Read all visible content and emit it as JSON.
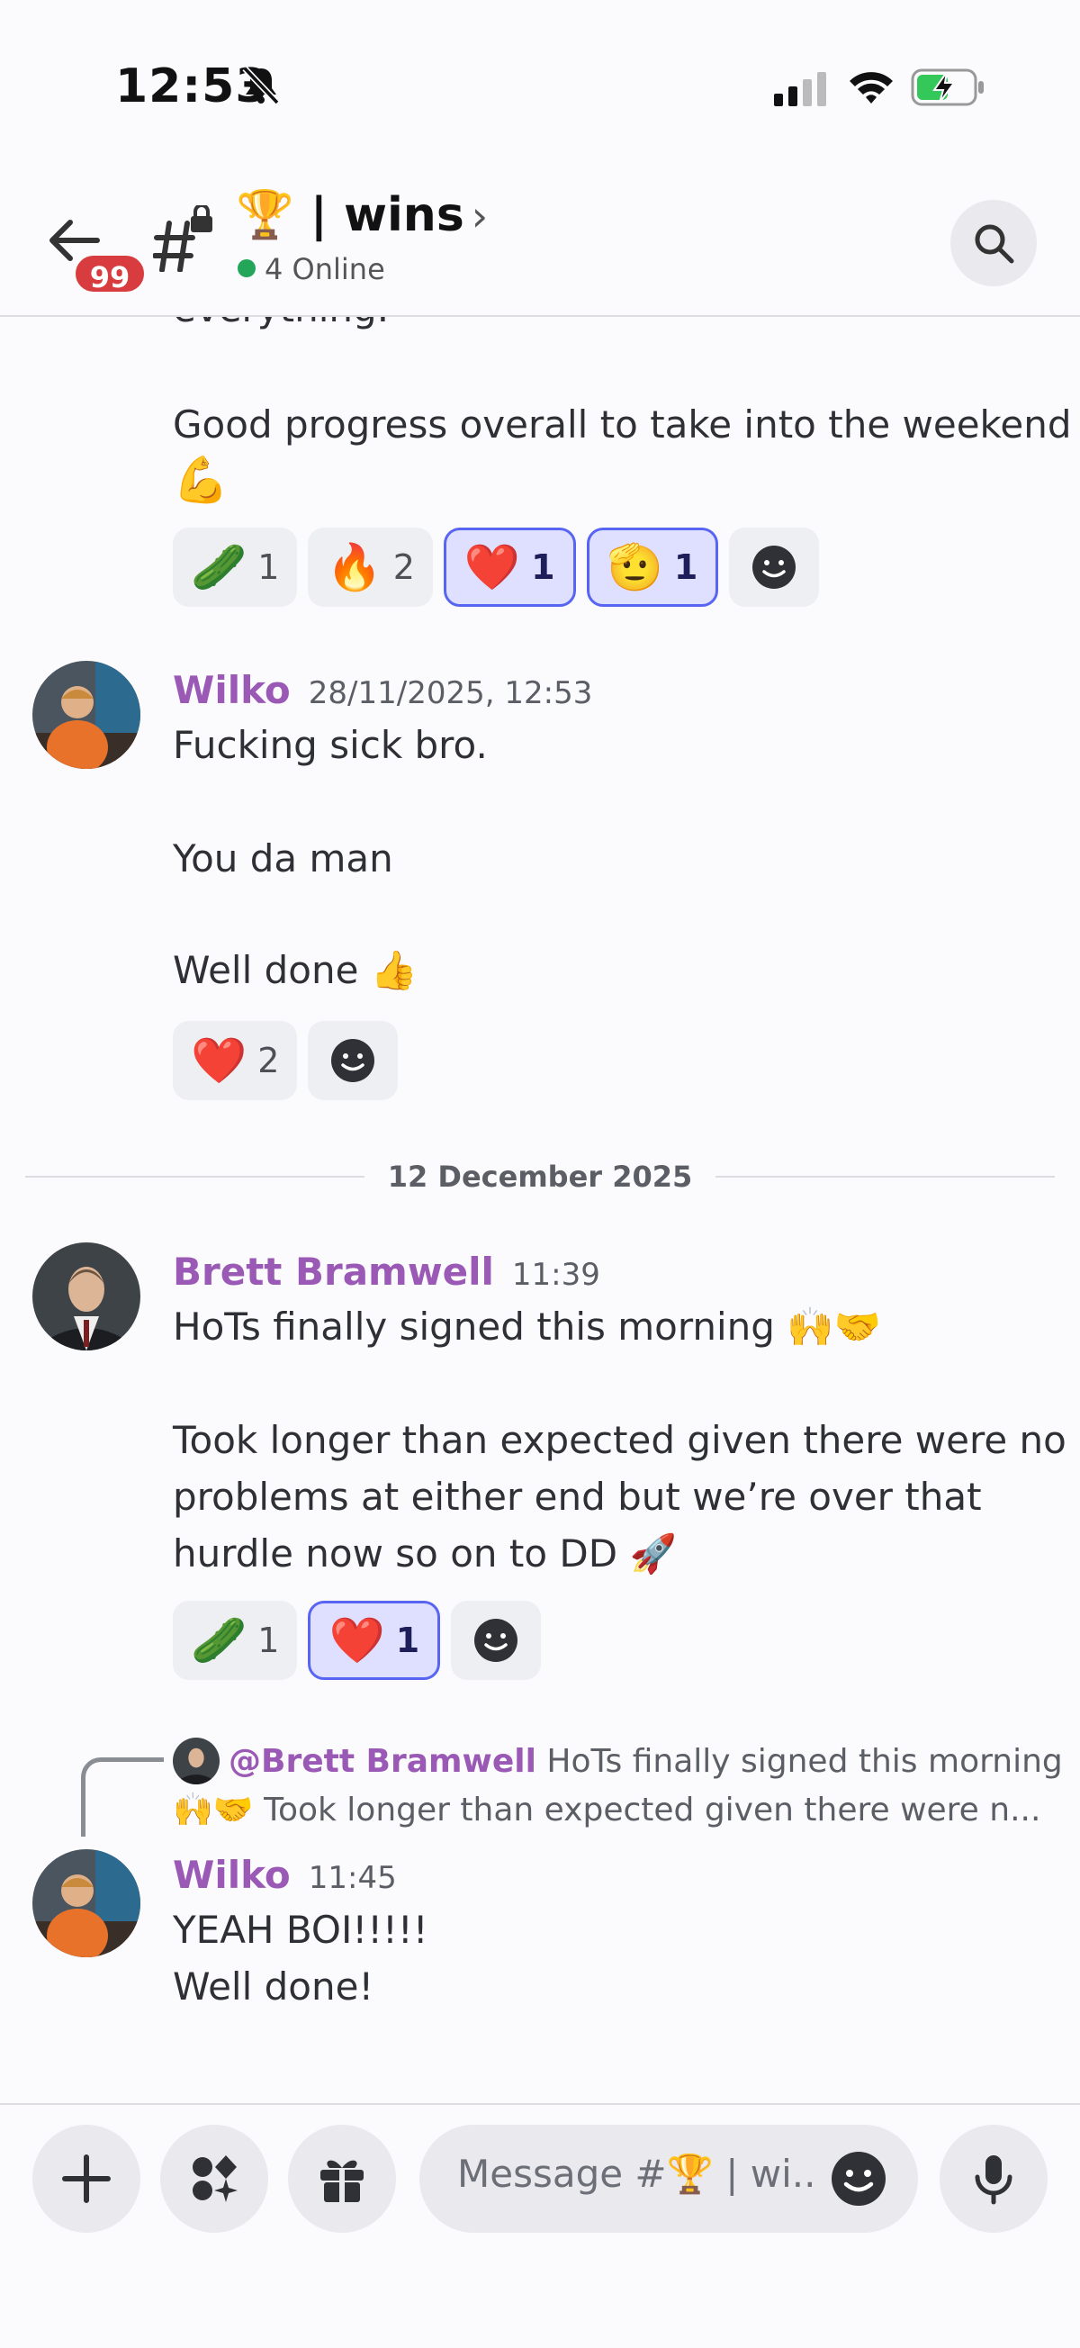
{
  "status_bar": {
    "time": "12:53"
  },
  "header": {
    "unread_badge": "99",
    "channel_name": "🏆 | wins",
    "chevron": "›",
    "online": "4 Online"
  },
  "messages": [
    {
      "type": "continuation",
      "cut_text": "everything.",
      "text": [
        "Good progress overall to take into the weekend",
        "💪"
      ],
      "reactions": [
        {
          "emoji": "🥒",
          "count": "1",
          "mine": false
        },
        {
          "emoji": "🔥",
          "count": "2",
          "mine": false
        },
        {
          "emoji": "❤️",
          "count": "1",
          "mine": true
        },
        {
          "emoji": "🫡",
          "count": "1",
          "mine": true
        }
      ]
    },
    {
      "author": "Wilko",
      "timestamp": "28/11/2025, 12:53",
      "text": [
        "Fucking sick bro.",
        "You da man",
        "Well done 👍"
      ],
      "reactions": [
        {
          "emoji": "❤️",
          "count": "2",
          "mine": false
        }
      ]
    },
    {
      "divider": "12 December 2025"
    },
    {
      "author": "Brett Bramwell",
      "timestamp": "11:39",
      "text": [
        "HoTs finally signed this morning 🙌🤝",
        "Took longer than expected given there were no",
        "problems at either end but we’re over that",
        "hurdle now so on to DD 🚀"
      ],
      "reactions": [
        {
          "emoji": "🥒",
          "count": "1",
          "mine": false
        },
        {
          "emoji": "❤️",
          "count": "1",
          "mine": true
        }
      ]
    },
    {
      "reply_to_author": "@Brett Bramwell",
      "reply_preview_1": "HoTs finally signed this morning",
      "reply_preview_2": "🙌🤝 Took longer than expected given there were n...",
      "author": "Wilko",
      "timestamp": "11:45",
      "text": [
        "YEAH BOI!!!!!",
        "Well done!"
      ]
    }
  ],
  "composer": {
    "placeholder": "Message #🏆 | wi.."
  },
  "colors": {
    "username": "#9b59b6",
    "badge": "#d83c3e",
    "online_dot": "#23a55a",
    "reaction_mine_border": "#5865f2"
  }
}
